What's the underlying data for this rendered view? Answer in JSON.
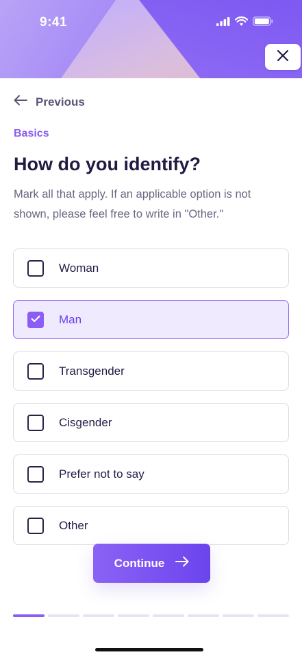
{
  "status_bar": {
    "time": "9:41"
  },
  "nav": {
    "previous_label": "Previous"
  },
  "section_label": "Basics",
  "question": {
    "title": "How do you identify?",
    "description": "Mark all that apply. If an applicable option is not shown, please feel free to write in \"Other.\""
  },
  "options": [
    {
      "label": "Woman",
      "checked": false
    },
    {
      "label": "Man",
      "checked": true
    },
    {
      "label": "Transgender",
      "checked": false
    },
    {
      "label": "Cisgender",
      "checked": false
    },
    {
      "label": "Prefer not to say",
      "checked": false
    },
    {
      "label": "Other",
      "checked": false
    }
  ],
  "continue_label": "Continue",
  "progress": {
    "total_steps": 8,
    "current_step": 1
  },
  "colors": {
    "accent": "#8b5cf6",
    "text": "#241b45",
    "muted": "#6b6682"
  },
  "icons": [
    "cellular-signal-icon",
    "wifi-icon",
    "battery-icon",
    "close-icon",
    "arrow-left-icon",
    "check-icon",
    "arrow-right-icon"
  ]
}
